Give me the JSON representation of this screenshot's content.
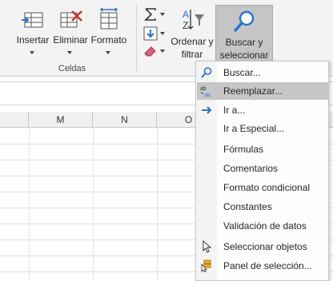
{
  "ribbon": {
    "celdas": {
      "insertar": "Insertar",
      "eliminar": "Eliminar",
      "formato": "Formato",
      "group_label": "Celdas"
    },
    "edicion": {
      "ordenar_line1": "Ordenar y",
      "ordenar_line2": "filtrar",
      "buscar_line1": "Buscar y",
      "buscar_line2": "seleccionar",
      "group_label_partial": "E"
    }
  },
  "columns": [
    "M",
    "N",
    "O"
  ],
  "menu": {
    "items": [
      {
        "label": "Buscar...",
        "icon": "search-icon"
      },
      {
        "label": "Reemplazar...",
        "icon": "replace-icon"
      },
      {
        "label": "Ir a...",
        "icon": "arrow-right-icon"
      },
      {
        "label": "Ir a Especial...",
        "icon": ""
      },
      {
        "label": "Fórmulas",
        "icon": ""
      },
      {
        "label": "Comentarios",
        "icon": ""
      },
      {
        "label": "Formato condicional",
        "icon": ""
      },
      {
        "label": "Constantes",
        "icon": ""
      },
      {
        "label": "Validación de datos",
        "icon": ""
      },
      {
        "label": "Seleccionar objetos",
        "icon": "pointer-icon"
      },
      {
        "label": "Panel de selección...",
        "icon": "selection-pane-icon"
      }
    ],
    "highlighted_label": "Reemplazar..."
  },
  "colors": {
    "ribbon_bg": "#f3f3f3",
    "accent_blue": "#2b74c7",
    "delete_red": "#c0392b",
    "highlight": "#c6c6c6"
  }
}
